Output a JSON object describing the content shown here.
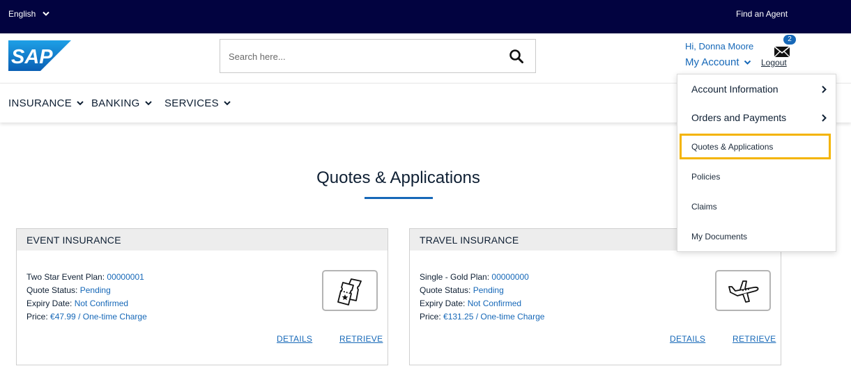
{
  "topbar": {
    "language": "English",
    "find_agent": "Find an Agent"
  },
  "header": {
    "logo_text": "SAP",
    "search_placeholder": "Search here...",
    "greeting": "Hi, Donna Moore",
    "my_account": "My Account",
    "mail_count": "2",
    "logout": "Logout"
  },
  "nav": {
    "items": [
      {
        "label": "INSURANCE"
      },
      {
        "label": "BANKING"
      },
      {
        "label": "SERVICES"
      }
    ]
  },
  "page": {
    "title": "Quotes & Applications"
  },
  "cards": [
    {
      "heading": "EVENT INSURANCE",
      "plan_label": "Two Star Event Plan:",
      "plan_value": "00000001",
      "status_label": "Quote Status:",
      "status_value": "Pending",
      "expiry_label": "Expiry Date:",
      "expiry_value": "Not Confirmed",
      "price_label": "Price:",
      "price_value": "€47.99 / One-time Charge",
      "icon": "tickets-icon",
      "details": "DETAILS",
      "retrieve": "RETRIEVE"
    },
    {
      "heading": "TRAVEL INSURANCE",
      "plan_label": "Single - Gold Plan:",
      "plan_value": "00000000",
      "status_label": "Quote Status:",
      "status_value": "Pending",
      "expiry_label": "Expiry Date:",
      "expiry_value": "Not Confirmed",
      "price_label": "Price:",
      "price_value": "€131.25 / One-time Charge",
      "icon": "airplane-icon",
      "details": "DETAILS",
      "retrieve": "RETRIEVE"
    }
  ],
  "account_menu": {
    "items": [
      {
        "label": "Account Information"
      },
      {
        "label": "Orders and Payments"
      },
      {
        "label": "Quotes & Applications"
      },
      {
        "label": "Policies"
      },
      {
        "label": "Claims"
      },
      {
        "label": "My Documents"
      }
    ]
  },
  "colors": {
    "topbar": "#020340",
    "accent": "#1668b8",
    "highlight": "#f4b400"
  }
}
